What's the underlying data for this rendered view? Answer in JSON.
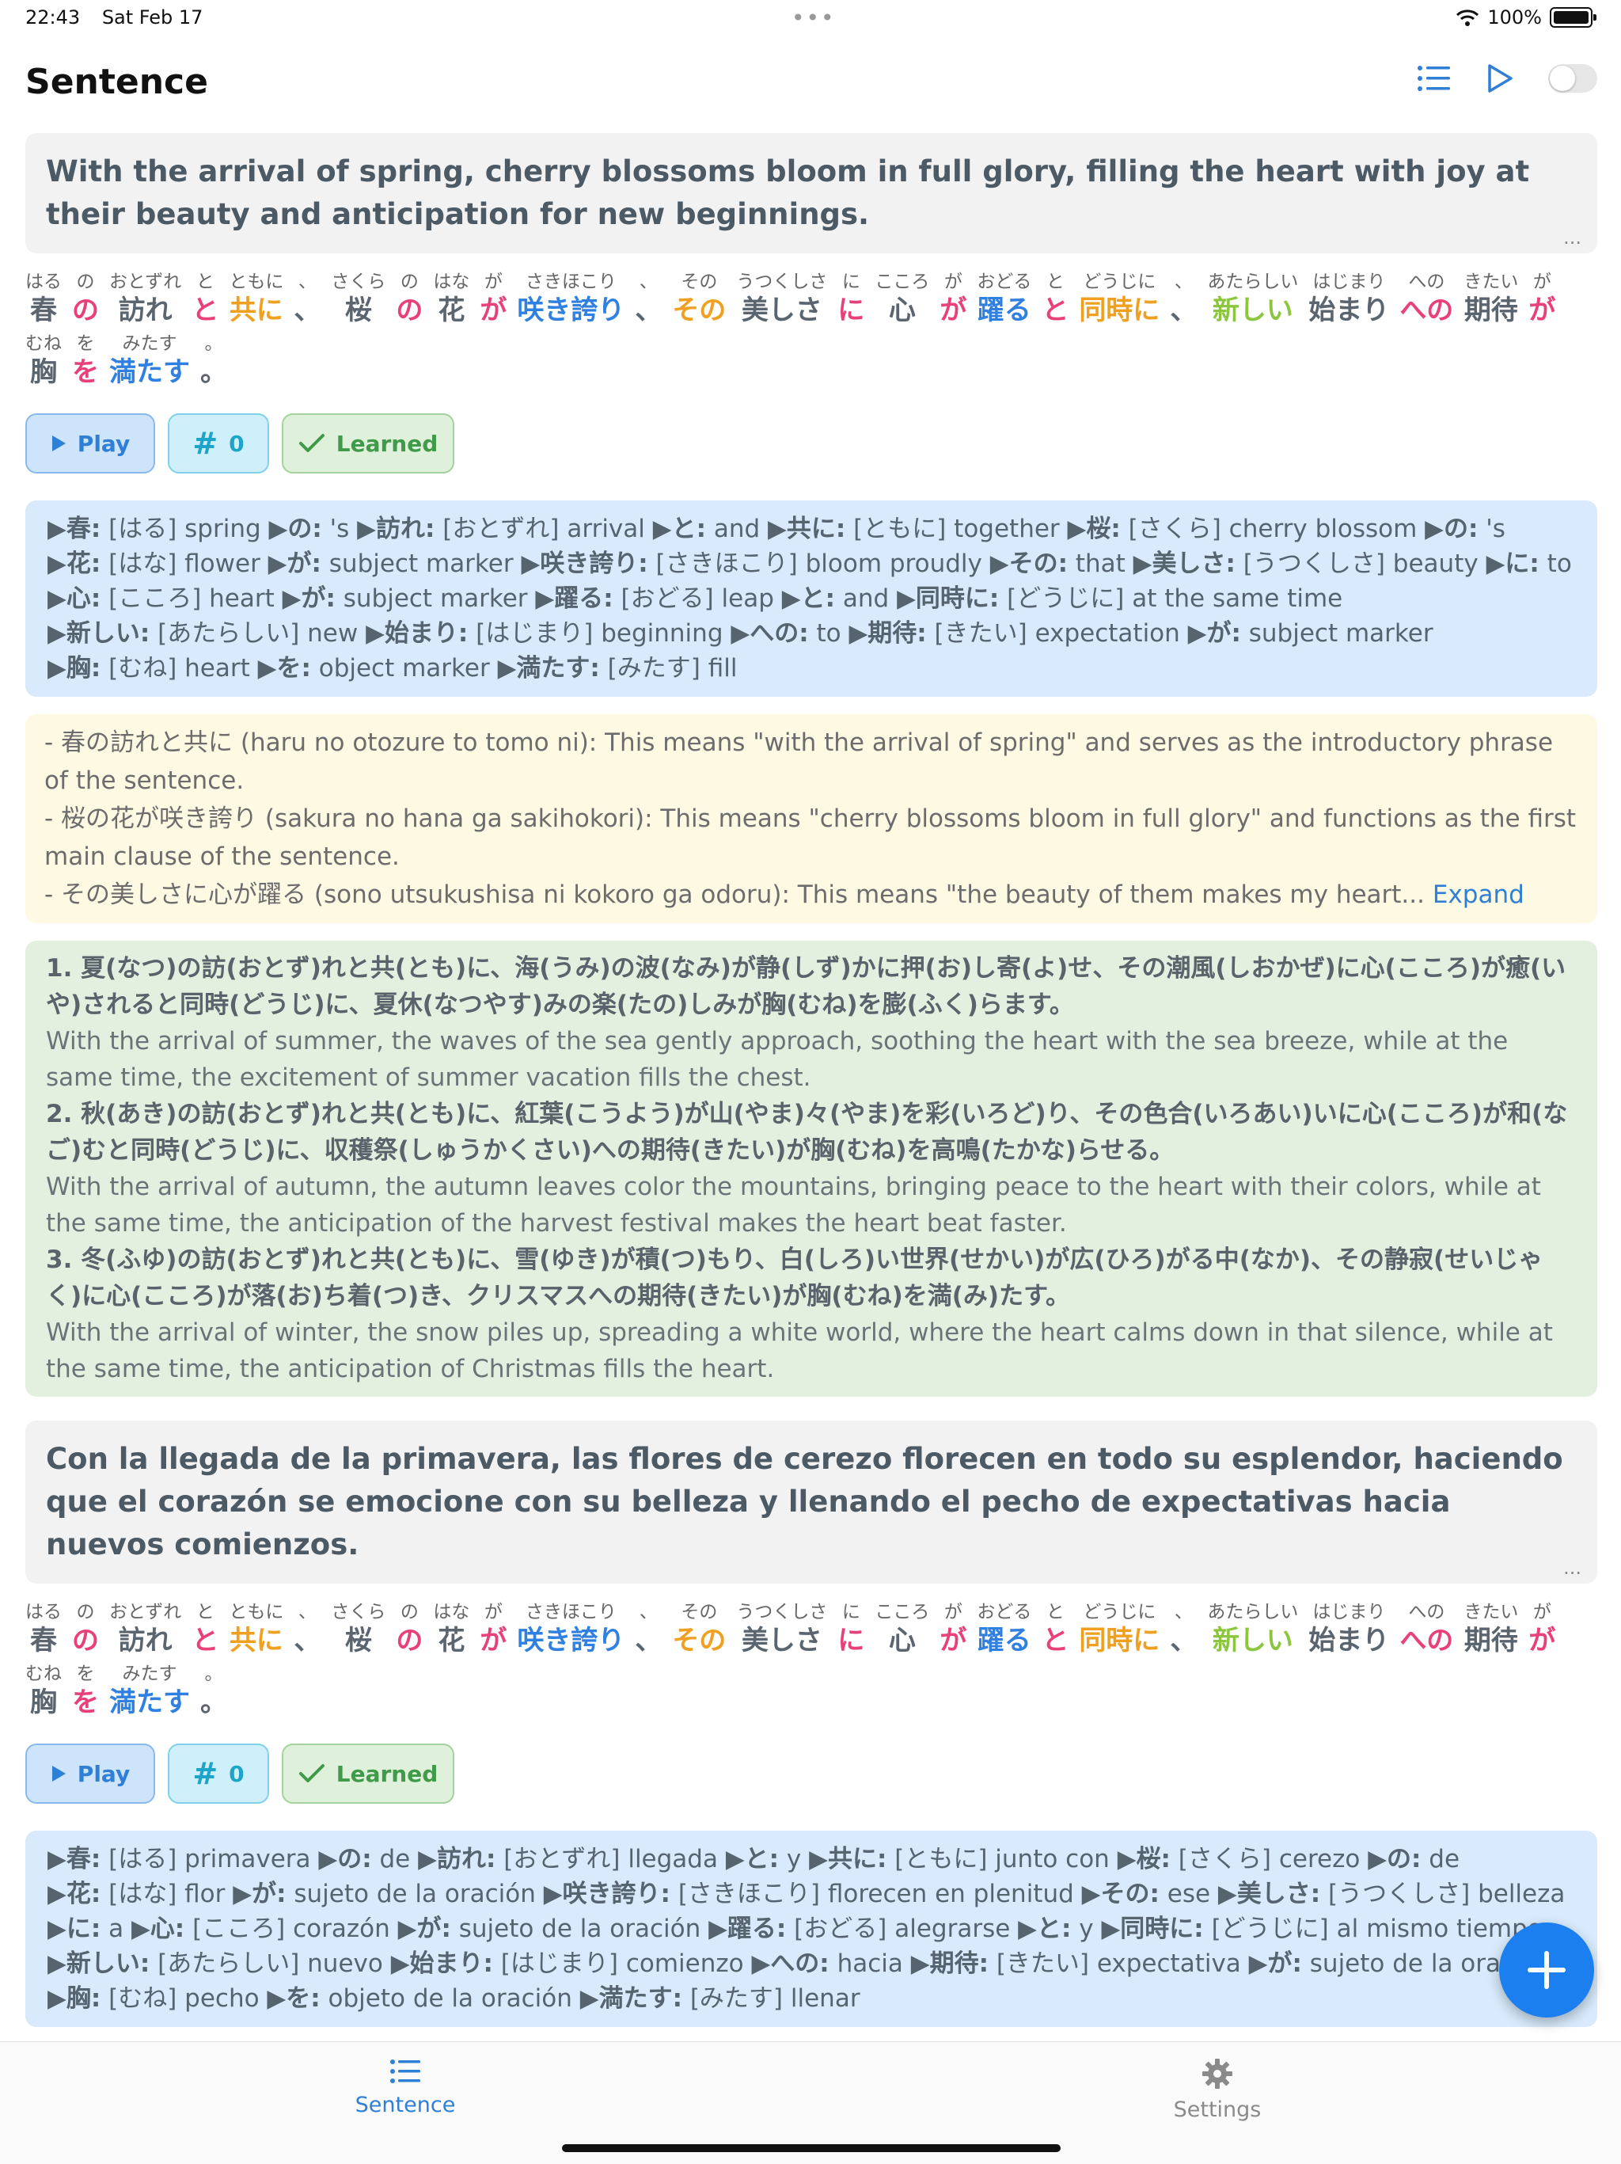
{
  "status_bar": {
    "time": "22:43",
    "date": "Sat Feb 17",
    "battery": "100%"
  },
  "navbar": {
    "title": "Sentence",
    "icons": [
      "list-icon",
      "play-icon",
      "toggle"
    ]
  },
  "card1": {
    "sentence": "With the arrival of spring, cherry blossoms bloom in full glory, filling the heart with joy at their beauty and anticipation for new beginnings.",
    "more": "...",
    "tokens": [
      {
        "r": "はる",
        "b": "春",
        "c": "#5a6570"
      },
      {
        "r": "の",
        "b": "の",
        "c": "#e8407a"
      },
      {
        "r": "おとずれ",
        "b": "訪れ",
        "c": "#5a6570"
      },
      {
        "r": "と",
        "b": "と",
        "c": "#e8407a"
      },
      {
        "r": "ともに",
        "b": "共に",
        "c": "#f0a020"
      },
      {
        "r": "、",
        "b": "、",
        "c": "#5a6570"
      },
      {
        "r": "さくら",
        "b": "桜",
        "c": "#5a6570"
      },
      {
        "r": "の",
        "b": "の",
        "c": "#e8407a"
      },
      {
        "r": "はな",
        "b": "花",
        "c": "#5a6570"
      },
      {
        "r": "が",
        "b": "が",
        "c": "#e8407a"
      },
      {
        "r": "さきほこり",
        "b": "咲き誇り",
        "c": "#2f80e0"
      },
      {
        "r": "、",
        "b": "、",
        "c": "#5a6570"
      },
      {
        "r": "その",
        "b": "その",
        "c": "#f0a020"
      },
      {
        "r": "うつくしさ",
        "b": "美しさ",
        "c": "#5a6570"
      },
      {
        "r": "に",
        "b": "に",
        "c": "#e8407a"
      },
      {
        "r": "こころ",
        "b": "心",
        "c": "#5a6570"
      },
      {
        "r": "が",
        "b": "が",
        "c": "#e8407a"
      },
      {
        "r": "おどる",
        "b": "躍る",
        "c": "#2f80e0"
      },
      {
        "r": "と",
        "b": "と",
        "c": "#e8407a"
      },
      {
        "r": "どうじに",
        "b": "同時に",
        "c": "#f0a020"
      },
      {
        "r": "、",
        "b": "、",
        "c": "#5a6570"
      },
      {
        "r": "あたらしい",
        "b": "新しい",
        "c": "#8cc63e"
      },
      {
        "r": "はじまり",
        "b": "始まり",
        "c": "#5a6570"
      },
      {
        "r": "への",
        "b": "への",
        "c": "#e8407a"
      },
      {
        "r": "きたい",
        "b": "期待",
        "c": "#5a6570"
      },
      {
        "r": "が",
        "b": "が",
        "c": "#e8407a"
      },
      {
        "r": "むね",
        "b": "胸",
        "c": "#5a6570"
      },
      {
        "r": "を",
        "b": "を",
        "c": "#e8407a"
      },
      {
        "r": "みたす",
        "b": "満たす",
        "c": "#2f80e0"
      },
      {
        "r": "。",
        "b": "。",
        "c": "#5a6570"
      }
    ],
    "buttons": {
      "play": "Play",
      "count_symbol": "#",
      "count": "0",
      "learned": "Learned"
    },
    "vocab": [
      [
        [
          "▶春:",
          " [はる] spring "
        ],
        [
          "▶の:",
          " 's "
        ],
        [
          "▶訪れ:",
          " [おとずれ] arrival "
        ],
        [
          "▶と:",
          " and "
        ],
        [
          "▶共に:",
          " [ともに] together "
        ],
        [
          "▶桜:",
          " [さくら] cherry blossom "
        ],
        [
          "▶の:",
          " 's"
        ]
      ],
      [
        [
          "▶花:",
          " [はな] flower "
        ],
        [
          "▶が:",
          " subject marker "
        ],
        [
          "▶咲き誇り:",
          " [さきほこり] bloom proudly "
        ],
        [
          "▶その:",
          " that "
        ],
        [
          "▶美しさ:",
          " [うつくしさ] beauty "
        ],
        [
          "▶に:",
          " to"
        ]
      ],
      [
        [
          "▶心:",
          " [こころ] heart "
        ],
        [
          "▶が:",
          " subject marker "
        ],
        [
          "▶躍る:",
          " [おどる] leap "
        ],
        [
          "▶と:",
          " and "
        ],
        [
          "▶同時に:",
          " [どうじに] at the same time"
        ]
      ],
      [
        [
          "▶新しい:",
          " [あたらしい] new "
        ],
        [
          "▶始まり:",
          " [はじまり] beginning "
        ],
        [
          "▶への:",
          " to "
        ],
        [
          "▶期待:",
          " [きたい] expectation "
        ],
        [
          "▶が:",
          " subject marker"
        ]
      ],
      [
        [
          "▶胸:",
          " [むね] heart "
        ],
        [
          "▶を:",
          " object marker "
        ],
        [
          "▶満たす:",
          " [みたす] fill"
        ]
      ]
    ],
    "grammar": [
      "- 春の訪れと共に (haru no otozure to tomo ni): This means \"with the arrival of spring\" and serves as the introductory phrase of the sentence.",
      "- 桜の花が咲き誇り (sakura no hana ga sakihokori): This means \"cherry blossoms bloom in full glory\" and functions as the first main clause of the sentence.",
      "- その美しさに心が躍る (sono utsukushisa ni kokoro ga odoru): This means \"the beauty of them makes my heart..."
    ],
    "expand": "Expand",
    "examples": [
      {
        "jp": "1. 夏(なつ)の訪(おとず)れと共(とも)に、海(うみ)の波(なみ)が静(しず)かに押(お)し寄(よ)せ、その潮風(しおかぜ)に心(こころ)が癒(いや)されると同時(どうじ)に、夏休(なつやす)みの楽(たの)しみが胸(むね)を膨(ふく)らます。",
        "en": "With the arrival of summer, the waves of the sea gently approach, soothing the heart with the sea breeze, while at the same time, the excitement of summer vacation fills the chest."
      },
      {
        "jp": "2. 秋(あき)の訪(おとず)れと共(とも)に、紅葉(こうよう)が山(やま)々(やま)を彩(いろど)り、その色合(いろあい)いに心(こころ)が和(なご)むと同時(どうじ)に、収穫祭(しゅうかくさい)への期待(きたい)が胸(むね)を高鳴(たかな)らせる。",
        "en": "With the arrival of autumn, the autumn leaves color the mountains, bringing peace to the heart with their colors, while at the same time, the anticipation of the harvest festival makes the heart beat faster."
      },
      {
        "jp": "3. 冬(ふゆ)の訪(おとず)れと共(とも)に、雪(ゆき)が積(つ)もり、白(しろ)い世界(せかい)が広(ひろ)がる中(なか)、その静寂(せいじゃく)に心(こころ)が落(お)ち着(つ)き、クリスマスへの期待(きたい)が胸(むね)を満(み)たす。",
        "en": "With the arrival of winter, the snow piles up, spreading a white world, where the heart calms down in that silence, while at the same time, the anticipation of Christmas fills the heart."
      }
    ]
  },
  "card2": {
    "sentence": "Con la llegada de la primavera, las flores de cerezo florecen en todo su esplendor, haciendo que el corazón se emocione con su belleza y llenando el pecho de expectativas hacia nuevos comienzos.",
    "more": "...",
    "buttons": {
      "play": "Play",
      "count_symbol": "#",
      "count": "0",
      "learned": "Learned"
    },
    "vocab": [
      [
        [
          "▶春:",
          " [はる] primavera "
        ],
        [
          "▶の:",
          " de "
        ],
        [
          "▶訪れ:",
          " [おとずれ] llegada "
        ],
        [
          "▶と:",
          " y "
        ],
        [
          "▶共に:",
          " [ともに] junto con "
        ],
        [
          "▶桜:",
          " [さくら] cerezo "
        ],
        [
          "▶の:",
          " de"
        ]
      ],
      [
        [
          "▶花:",
          " [はな] flor "
        ],
        [
          "▶が:",
          " sujeto de la oración "
        ],
        [
          "▶咲き誇り:",
          " [さきほこり] florecen en plenitud "
        ],
        [
          "▶その:",
          " ese "
        ],
        [
          "▶美しさ:",
          " [うつくしさ] belleza"
        ]
      ],
      [
        [
          "▶に:",
          " a "
        ],
        [
          "▶心:",
          " [こころ] corazón "
        ],
        [
          "▶が:",
          " sujeto de la oración "
        ],
        [
          "▶躍る:",
          " [おどる] alegrarse "
        ],
        [
          "▶と:",
          " y "
        ],
        [
          "▶同時に:",
          " [どうじに] al mismo tiempo"
        ]
      ],
      [
        [
          "▶新しい:",
          " [あたらしい] nuevo "
        ],
        [
          "▶始まり:",
          " [はじまり] comienzo "
        ],
        [
          "▶への:",
          " hacia "
        ],
        [
          "▶期待:",
          " [きたい] expectativa "
        ],
        [
          "▶が:",
          " sujeto de la oración"
        ]
      ],
      [
        [
          "▶胸:",
          " [むね] pecho "
        ],
        [
          "▶を:",
          " objeto de la oración "
        ],
        [
          "▶満たす:",
          " [みたす] llenar"
        ]
      ]
    ]
  },
  "tabbar": {
    "sentence": "Sentence",
    "settings": "Settings"
  },
  "colors": {
    "accent": "#2f7fd6",
    "fab": "#1b7ff0"
  }
}
